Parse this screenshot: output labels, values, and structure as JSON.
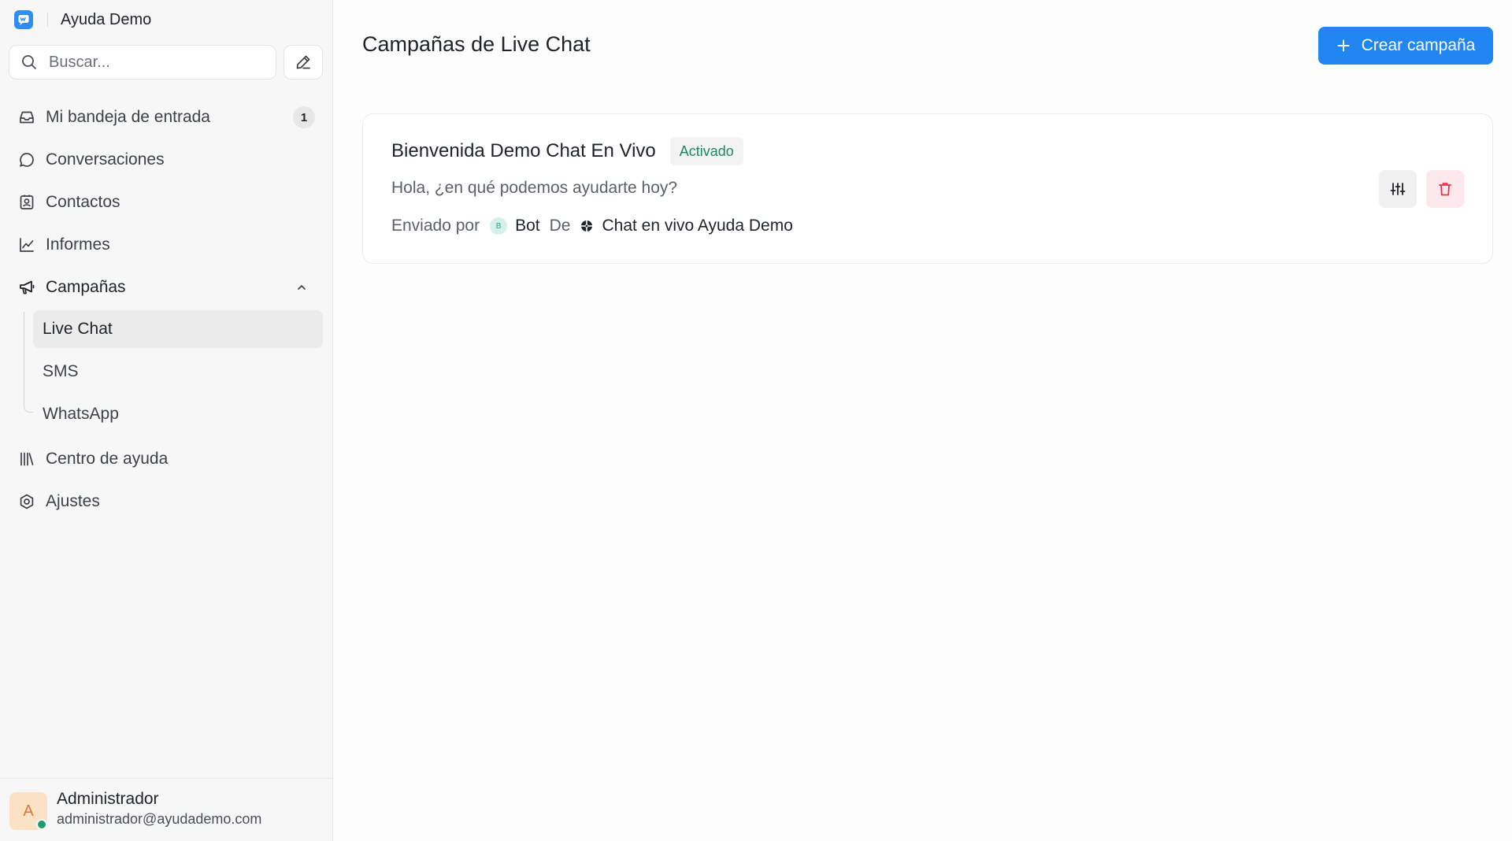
{
  "brand": {
    "name": "Ayuda Demo"
  },
  "search": {
    "placeholder": "Buscar..."
  },
  "nav": {
    "inbox": {
      "label": "Mi bandeja de entrada",
      "badge": "1"
    },
    "conversations": {
      "label": "Conversaciones"
    },
    "contacts": {
      "label": "Contactos"
    },
    "reports": {
      "label": "Informes"
    },
    "campaigns": {
      "label": "Campañas"
    },
    "campaign_sub": [
      "Live Chat",
      "SMS",
      "WhatsApp"
    ],
    "help_center": {
      "label": "Centro de ayuda"
    },
    "settings": {
      "label": "Ajustes"
    }
  },
  "user": {
    "initial": "A",
    "name": "Administrador",
    "email": "administrador@ayudademo.com",
    "status_color": "#1f9d70"
  },
  "main": {
    "title": "Campañas de Live Chat",
    "create_label": "Crear campaña"
  },
  "campaign": {
    "title": "Bienvenida Demo Chat En Vivo",
    "status": "Activado",
    "message": "Hola, ¿en qué podemos ayudarte hoy?",
    "sent_by_label": "Enviado por",
    "sender_initial": "B",
    "sender": "Bot",
    "from_label": "De",
    "inbox": "Chat en vivo Ayuda Demo"
  },
  "colors": {
    "accent": "#2186f2",
    "active_green": "#198a5e",
    "danger": "#e0334f"
  }
}
